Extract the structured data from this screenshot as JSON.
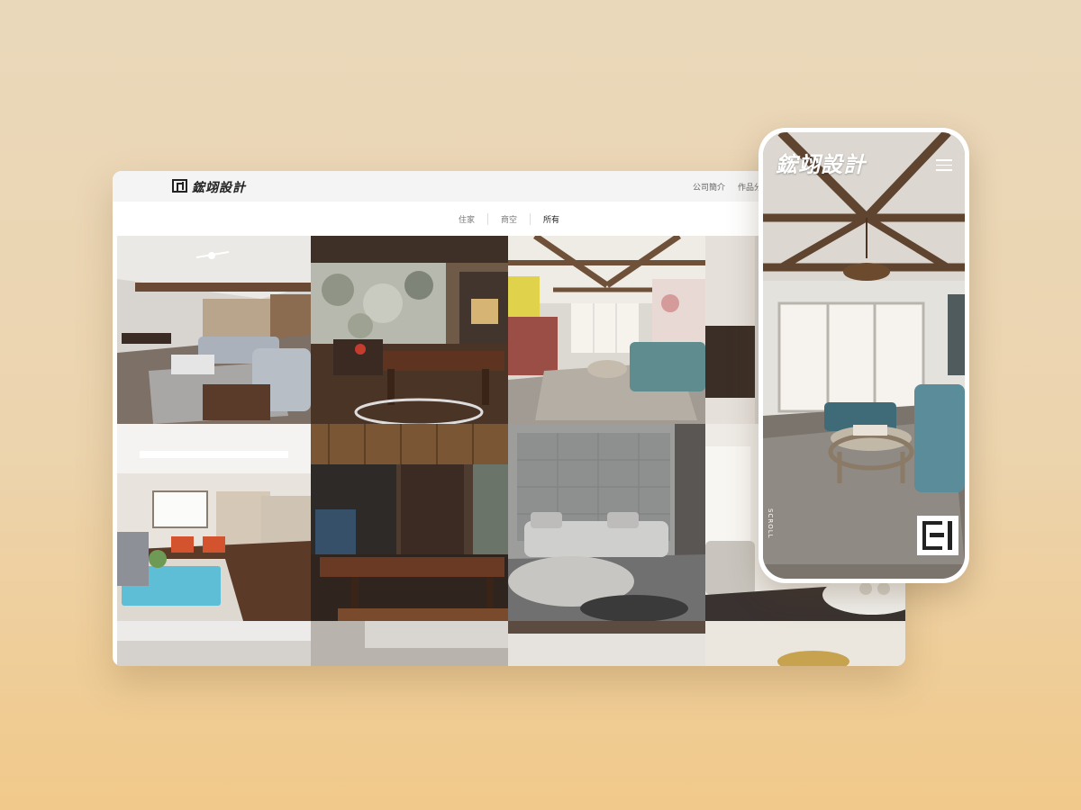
{
  "desktop": {
    "logo_text": "鋐翊設計",
    "nav": [
      "公司簡介",
      "作品分類"
    ],
    "filters": [
      {
        "label": "住家",
        "active": false
      },
      {
        "label": "商空",
        "active": false
      },
      {
        "label": "所有",
        "active": true
      }
    ]
  },
  "mobile": {
    "logo_text": "鋐翊設計",
    "scroll_label": "SCROLL"
  },
  "colors": {
    "background_top": "#ead8bb",
    "background_bottom": "#f1c98a",
    "card": "#ffffff",
    "header": "#f4f4f4"
  }
}
